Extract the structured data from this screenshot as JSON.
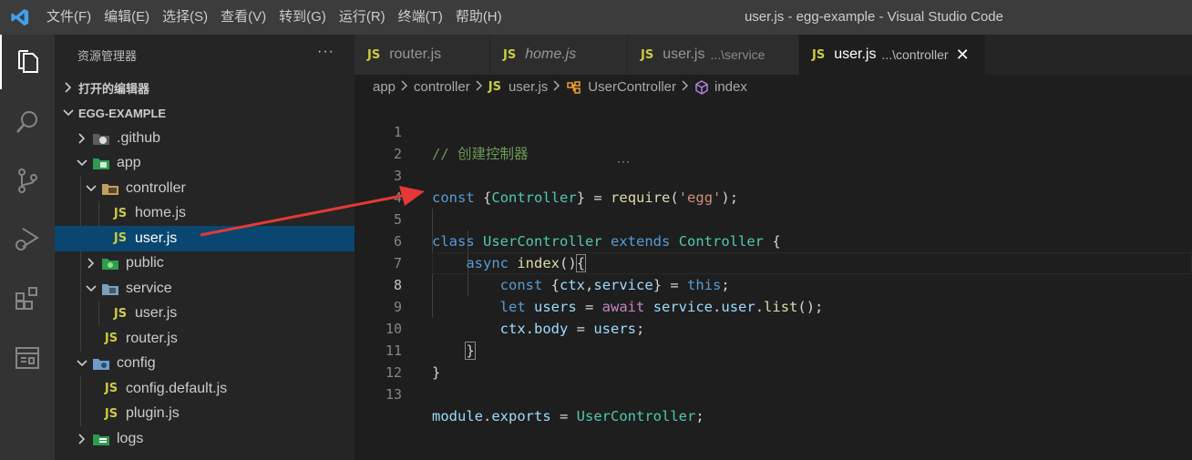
{
  "window": {
    "title": "user.js - egg-example - Visual Studio Code"
  },
  "menu": [
    {
      "label": "文件(F)"
    },
    {
      "label": "编辑(E)"
    },
    {
      "label": "选择(S)"
    },
    {
      "label": "查看(V)"
    },
    {
      "label": "转到(G)"
    },
    {
      "label": "运行(R)"
    },
    {
      "label": "终端(T)"
    },
    {
      "label": "帮助(H)"
    }
  ],
  "activity_bar": [
    "explorer-icon",
    "search-icon",
    "source-control-icon",
    "run-debug-icon",
    "extensions-icon",
    "remote-explorer-icon"
  ],
  "sidebar": {
    "title": "资源管理器",
    "more": "···",
    "open_editors": "打开的编辑器",
    "project": "EGG-EXAMPLE",
    "tree": [
      {
        "label": ".github"
      },
      {
        "label": "app"
      },
      {
        "label": "controller"
      },
      {
        "label": "home.js"
      },
      {
        "label": "user.js"
      },
      {
        "label": "public"
      },
      {
        "label": "service"
      },
      {
        "label": "user.js"
      },
      {
        "label": "router.js"
      },
      {
        "label": "config"
      },
      {
        "label": "config.default.js"
      },
      {
        "label": "plugin.js"
      },
      {
        "label": "logs"
      }
    ]
  },
  "tabs": [
    {
      "badge": "JS",
      "label": "router.js",
      "desc": ""
    },
    {
      "badge": "JS",
      "label": "home.js",
      "desc": ""
    },
    {
      "badge": "JS",
      "label": "user.js",
      "desc": "...\\service"
    },
    {
      "badge": "JS",
      "label": "user.js",
      "desc": "...\\controller",
      "close": "✕"
    }
  ],
  "breadcrumb": [
    "app",
    "controller",
    "JS",
    "user.js",
    "UserController",
    "index"
  ],
  "editor": {
    "line_numbers": [
      "1",
      "2",
      "3",
      "4",
      "5",
      "6",
      "7",
      "8",
      "9",
      "10",
      "11",
      "12",
      "13"
    ],
    "current_line": 8,
    "tokens": {
      "l1": "// 创建控制器",
      "const": "const",
      "ob": "{",
      "Controller": "Controller",
      "cb": "}",
      "eq": " = ",
      "require": "require",
      "lp": "(",
      "egg": "'egg'",
      "rps": ");",
      "class": "class",
      "UserController": "UserController",
      "extends": "extends",
      "obrace": " {",
      "async": "async",
      "index": "index",
      "parens": "()",
      "let": "let",
      "users": "users",
      "await": "await",
      "service": "service",
      "dot": ".",
      "user": "user",
      "list": "list",
      "callend": "();",
      "ctx": "ctx",
      "comma": ",",
      "this": "this",
      "semi": ";",
      "body": "body",
      "module": "module",
      "exports": "exports"
    }
  },
  "colors": {
    "arrow": "#e53935",
    "selection": "#094771",
    "js_badge": "#cbcb41"
  }
}
